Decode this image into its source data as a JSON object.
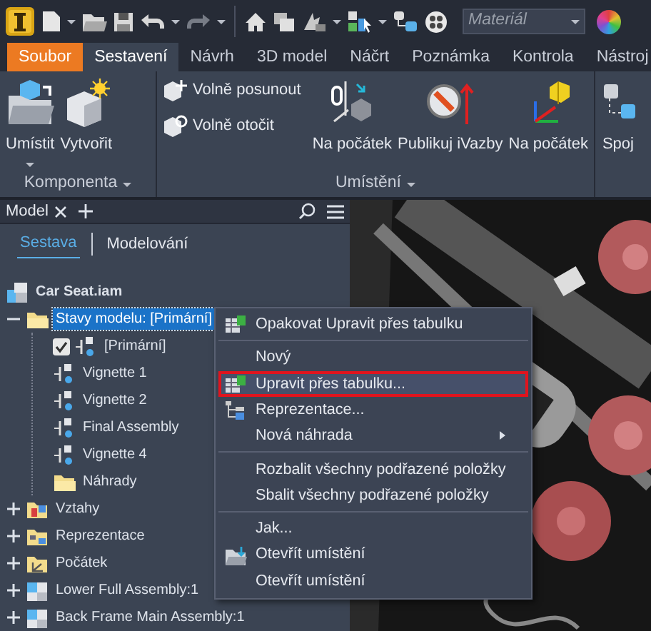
{
  "quick_access": {
    "material_field": {
      "placeholder": "Materiál"
    }
  },
  "ribbon_tabs": [
    {
      "label": "Soubor",
      "kind": "file",
      "selected": false
    },
    {
      "label": "Sestavení",
      "kind": "tab",
      "selected": true
    },
    {
      "label": "Návrh",
      "kind": "tab",
      "selected": false
    },
    {
      "label": "3D model",
      "kind": "tab",
      "selected": false
    },
    {
      "label": "Náčrt",
      "kind": "tab",
      "selected": false
    },
    {
      "label": "Poznámka",
      "kind": "tab",
      "selected": false
    },
    {
      "label": "Kontrola",
      "kind": "tab",
      "selected": false
    },
    {
      "label": "Nástroj",
      "kind": "tab",
      "selected": false
    }
  ],
  "ribbon_panels": [
    {
      "title": "Komponenta",
      "buttons": [
        {
          "label": "Umístit",
          "kind": "large",
          "dropdown": true
        },
        {
          "label": "Vytvořit",
          "kind": "large",
          "dropdown": false
        }
      ]
    },
    {
      "title": "Umístění",
      "buttons": [
        {
          "kind": "stack",
          "items": [
            {
              "label": "Volně posunout"
            },
            {
              "label": "Volně otočit"
            }
          ]
        },
        {
          "label": "Na počátek",
          "kind": "large",
          "dropdown": false
        },
        {
          "label": "Publikuj iVazby",
          "kind": "large",
          "dropdown": false
        },
        {
          "label": "Na počátek",
          "kind": "large",
          "dropdown": false
        }
      ]
    },
    {
      "buttons": [
        {
          "label": "Spoj",
          "kind": "large",
          "dropdown": false
        }
      ]
    }
  ],
  "browser": {
    "tabs": [
      {
        "label": "Model",
        "selected": true
      }
    ],
    "view_tabs": [
      {
        "label": "Sestava",
        "selected": true
      },
      {
        "label": "Modelování",
        "selected": false
      }
    ],
    "tree": [
      {
        "label": "Car Seat.iam",
        "kind": "assembly",
        "selected": false,
        "children": [
          {
            "label": "Stavy modelu: [Primární]",
            "kind": "folder",
            "selected": true,
            "expanded": true,
            "children": [
              {
                "label": "[Primární]",
                "kind": "state",
                "selected": false,
                "checked": true
              },
              {
                "label": "Vignette 1",
                "kind": "state",
                "selected": false
              },
              {
                "label": "Vignette 2",
                "kind": "state",
                "selected": false
              },
              {
                "label": "Final Assembly",
                "kind": "state",
                "selected": false
              },
              {
                "label": "Vignette 4",
                "kind": "state",
                "selected": false
              },
              {
                "label": "Náhrady",
                "kind": "folder",
                "selected": false
              }
            ]
          },
          {
            "label": "Vztahy",
            "kind": "relations",
            "selected": false,
            "expanded": false
          },
          {
            "label": "Reprezentace",
            "kind": "representations",
            "selected": false,
            "expanded": false
          },
          {
            "label": "Počátek",
            "kind": "origin",
            "selected": false,
            "expanded": false
          },
          {
            "label": "Lower Full Assembly:1",
            "kind": "subassembly",
            "selected": false,
            "expanded": false
          },
          {
            "label": "Back Frame Main Assembly:1",
            "kind": "subassembly",
            "selected": false,
            "expanded": false
          }
        ]
      }
    ]
  },
  "context_menu": {
    "items": [
      {
        "kind": "table",
        "label": "Opakovat Upravit přes tabulku",
        "selected": false,
        "submenu": false
      },
      {
        "kind": "separator"
      },
      {
        "kind": "plain",
        "label": "Nový",
        "selected": false,
        "submenu": false
      },
      {
        "kind": "table",
        "label": "Upravit přes tabulku...",
        "selected": true,
        "submenu": false
      },
      {
        "kind": "tree",
        "label": "Reprezentace...",
        "selected": false,
        "submenu": false
      },
      {
        "kind": "plain",
        "label": "Nová náhrada",
        "selected": false,
        "submenu": true
      },
      {
        "kind": "separator"
      },
      {
        "kind": "plain",
        "label": "Rozbalit všechny podřazené položky",
        "selected": false,
        "submenu": false
      },
      {
        "kind": "plain",
        "label": "Sbalit všechny podřazené položky",
        "selected": false,
        "submenu": false
      },
      {
        "kind": "separator"
      },
      {
        "kind": "plain",
        "label": "Jak...",
        "selected": false,
        "submenu": false
      },
      {
        "kind": "folder",
        "label": "Otevřít umístění",
        "selected": false,
        "submenu": false
      },
      {
        "kind": "plain",
        "label": "Otevřít umístění",
        "selected": false,
        "submenu": false
      }
    ]
  }
}
